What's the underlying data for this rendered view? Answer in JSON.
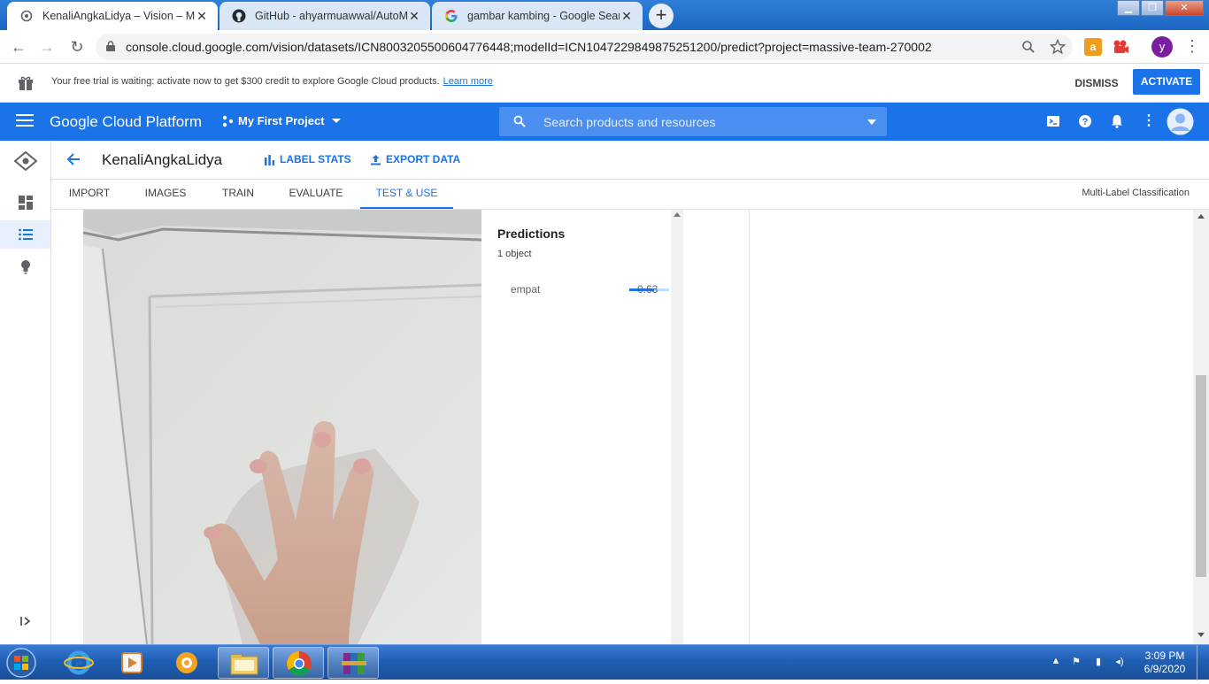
{
  "browser": {
    "tabs": [
      {
        "title": "KenaliAngkaLidya – Vision – My F",
        "icon": "gcp-icon",
        "active": true
      },
      {
        "title": "GitHub - ahyarmuawwal/AutoML",
        "icon": "github-icon",
        "active": false
      },
      {
        "title": "gambar kambing - Google Search",
        "icon": "google-icon",
        "active": false
      }
    ],
    "new_tab": "+",
    "url": "console.cloud.google.com/vision/datasets/ICN8003205500604776448;modelId=ICN1047229849875251200/predict?project=massive-team-270002",
    "profile_initial": "y"
  },
  "trial_banner": {
    "message": "Your free trial is waiting: activate now to get $300 credit to explore Google Cloud products.",
    "learn_more": "Learn more",
    "dismiss": "DISMISS",
    "activate": "ACTIVATE"
  },
  "gcp_header": {
    "product": "Google Cloud Platform",
    "project": "My First Project",
    "search_placeholder": "Search products and resources"
  },
  "dataset": {
    "name": "KenaliAngkaLidya",
    "label_stats": "LABEL STATS",
    "export_data": "EXPORT DATA"
  },
  "tabs": [
    {
      "label": "IMPORT",
      "active": false
    },
    {
      "label": "IMAGES",
      "active": false
    },
    {
      "label": "TRAIN",
      "active": false
    },
    {
      "label": "EVALUATE",
      "active": false
    },
    {
      "label": "TEST & USE",
      "active": true
    }
  ],
  "model_type": "Multi-Label Classification",
  "predictions": {
    "title": "Predictions",
    "count": "1 object",
    "items": [
      {
        "label": "empat",
        "score": "0.63",
        "score_value": 0.63
      }
    ]
  },
  "taskbar": {
    "time": "3:09 PM",
    "date": "6/9/2020"
  },
  "colors": {
    "gcp_blue": "#1a73e8",
    "chrome_frame": "#1d66c2"
  }
}
